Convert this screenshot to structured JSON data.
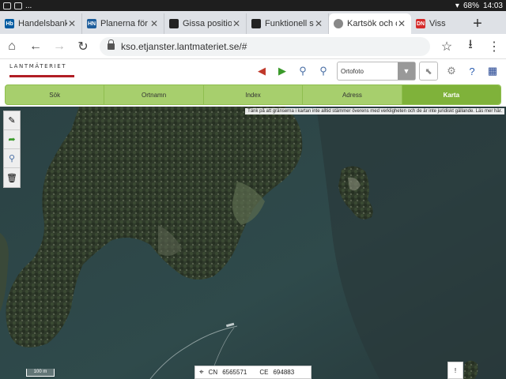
{
  "statusbar": {
    "left": "...",
    "battery": "68%",
    "time": "14:03"
  },
  "tabs": [
    {
      "icon": "Hb",
      "label": "Handelsbanken",
      "color": "#005aa0"
    },
    {
      "icon": "HN",
      "label": "Planerna för Väs",
      "color": "#1d5d9b"
    },
    {
      "icon": "",
      "label": "Gissa position S",
      "color": "#222222"
    },
    {
      "icon": "",
      "label": "Funktionell skjor",
      "color": "#222222"
    },
    {
      "icon": "",
      "label": "Kartsök och ortc",
      "color": "#888888"
    },
    {
      "icon": "DN",
      "label": "Viss",
      "color": "#d52a2a"
    }
  ],
  "navbar": {
    "url": "kso.etjanster.lantmateriet.se/#"
  },
  "app": {
    "logo": "LANTMÄTERIET",
    "layer_select": "Ortofoto",
    "nav": [
      "Sök",
      "Ortnamn",
      "Index",
      "Adress",
      "Karta"
    ],
    "active_nav": "Karta"
  },
  "map": {
    "disclaimer": "Tänk på att gränserna i kartan inte alltid stämmer överens med verkligheten och de är inte juridiskt gällande. Läs mer här.",
    "scale": "100 m",
    "coords": {
      "cn_label": "CN",
      "cn_value": "6565571",
      "ce_label": "CE",
      "ce_value": "694883"
    },
    "corner": "!"
  }
}
